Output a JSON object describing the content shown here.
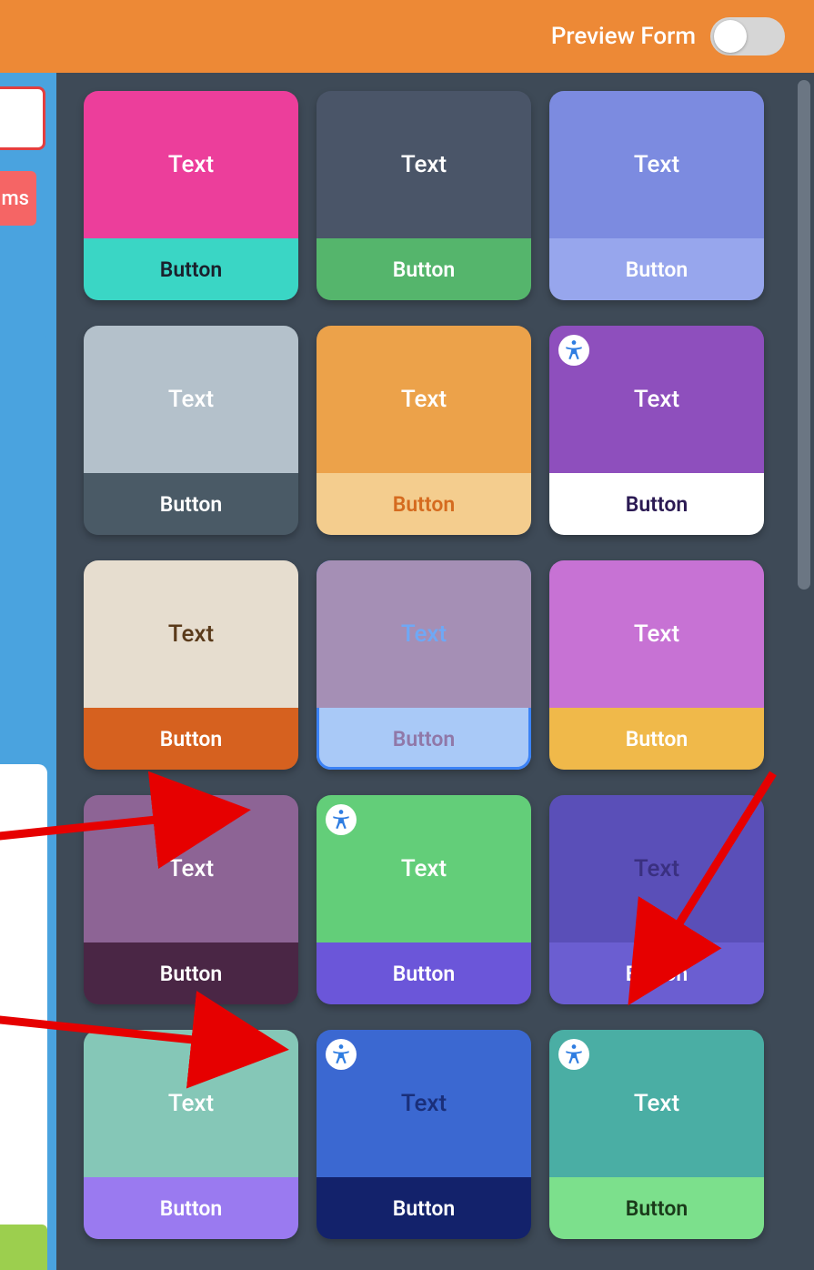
{
  "topbar": {
    "preview_label": "Preview Form",
    "toggle_on": false
  },
  "sidebar": {
    "tab_fragment": "ms"
  },
  "tiles": [
    {
      "text_label": "Text",
      "button_label": "Button",
      "top_bg": "#ec3e9b",
      "top_color": "#ffffff",
      "bottom_bg": "#3ad6c5",
      "bottom_color": "#1a202c",
      "a11y": false,
      "selected": false
    },
    {
      "text_label": "Text",
      "button_label": "Button",
      "top_bg": "#4a5568",
      "top_color": "#ffffff",
      "bottom_bg": "#55b56c",
      "bottom_color": "#ffffff",
      "a11y": false,
      "selected": false
    },
    {
      "text_label": "Text",
      "button_label": "Button",
      "top_bg": "#7c8be0",
      "top_color": "#ffffff",
      "bottom_bg": "#97a6ed",
      "bottom_color": "#ffffff",
      "a11y": false,
      "selected": false
    },
    {
      "text_label": "Text",
      "button_label": "Button",
      "top_bg": "#b4c1cb",
      "top_color": "#ffffff",
      "bottom_bg": "#4a5a66",
      "bottom_color": "#ffffff",
      "a11y": false,
      "selected": false
    },
    {
      "text_label": "Text",
      "button_label": "Button",
      "top_bg": "#eca24a",
      "top_color": "#ffffff",
      "bottom_bg": "#f4cd8e",
      "bottom_color": "#d56b1f",
      "a11y": false,
      "selected": false
    },
    {
      "text_label": "Text",
      "button_label": "Button",
      "top_bg": "#8e4fbd",
      "top_color": "#ffffff",
      "bottom_bg": "#ffffff",
      "bottom_color": "#2b1a53",
      "a11y": true,
      "selected": false
    },
    {
      "text_label": "Text",
      "button_label": "Button",
      "top_bg": "#e6ddcf",
      "top_color": "#5a3a1a",
      "bottom_bg": "#d6611f",
      "bottom_color": "#ffffff",
      "a11y": false,
      "selected": false
    },
    {
      "text_label": "Text",
      "button_label": "Button",
      "top_bg": "#a58fb5",
      "top_color": "#6fa8f5",
      "bottom_bg": "#a9c9f7",
      "bottom_color": "#9078a8",
      "a11y": false,
      "selected": true
    },
    {
      "text_label": "Text",
      "button_label": "Button",
      "top_bg": "#c772d4",
      "top_color": "#ffffff",
      "bottom_bg": "#f0b94a",
      "bottom_color": "#ffffff",
      "a11y": false,
      "selected": false
    },
    {
      "text_label": "Text",
      "button_label": "Button",
      "top_bg": "#8d6495",
      "top_color": "#ffffff",
      "bottom_bg": "#4a2645",
      "bottom_color": "#ffffff",
      "a11y": false,
      "selected": false
    },
    {
      "text_label": "Text",
      "button_label": "Button",
      "top_bg": "#63ce79",
      "top_color": "#ffffff",
      "bottom_bg": "#6b56d9",
      "bottom_color": "#ffffff",
      "a11y": true,
      "selected": false
    },
    {
      "text_label": "Text",
      "button_label": "Button",
      "top_bg": "#5a4fb8",
      "top_color": "#3a3080",
      "bottom_bg": "#6b5ed1",
      "bottom_color": "#ffffff",
      "a11y": false,
      "selected": false
    },
    {
      "text_label": "Text",
      "button_label": "Button",
      "top_bg": "#85c7b7",
      "top_color": "#ffffff",
      "bottom_bg": "#9a7af0",
      "bottom_color": "#ffffff",
      "a11y": false,
      "selected": false
    },
    {
      "text_label": "Text",
      "button_label": "Button",
      "top_bg": "#3b68d1",
      "top_color": "#1a2f7a",
      "bottom_bg": "#13226b",
      "bottom_color": "#ffffff",
      "a11y": true,
      "selected": false
    },
    {
      "text_label": "Text",
      "button_label": "Button",
      "top_bg": "#4aaea4",
      "top_color": "#ffffff",
      "bottom_bg": "#7ce08c",
      "bottom_color": "#1a3a1a",
      "a11y": true,
      "selected": false
    }
  ]
}
